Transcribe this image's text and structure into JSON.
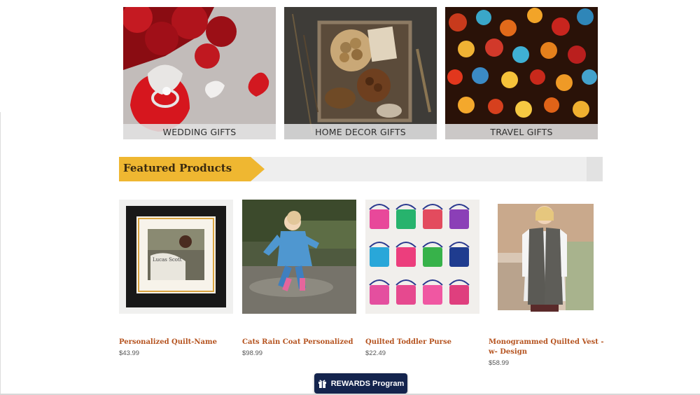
{
  "categories": [
    {
      "label": "WEDDING GIFTS"
    },
    {
      "label": "HOME DECOR GIFTS"
    },
    {
      "label": "TRAVEL GIFTS"
    }
  ],
  "featured": {
    "title": "Featured Products"
  },
  "products": [
    {
      "name": "Personalized Quilt-Name",
      "price": "$43.99",
      "image_text": "Lucas Scott"
    },
    {
      "name": "Cats Rain Coat Personalized",
      "price": "$98.99"
    },
    {
      "name": "Quilted Toddler Purse",
      "price": "$22.49"
    },
    {
      "name": "Monogrammed Quilted Vest -w- Design",
      "price": "$58.99"
    }
  ],
  "rewards": {
    "label": "REWARDS Program",
    "icon": "gift-icon"
  },
  "colors": {
    "accent": "#efb731",
    "product_name": "#b5531f",
    "rewards_bg": "#14244d"
  }
}
